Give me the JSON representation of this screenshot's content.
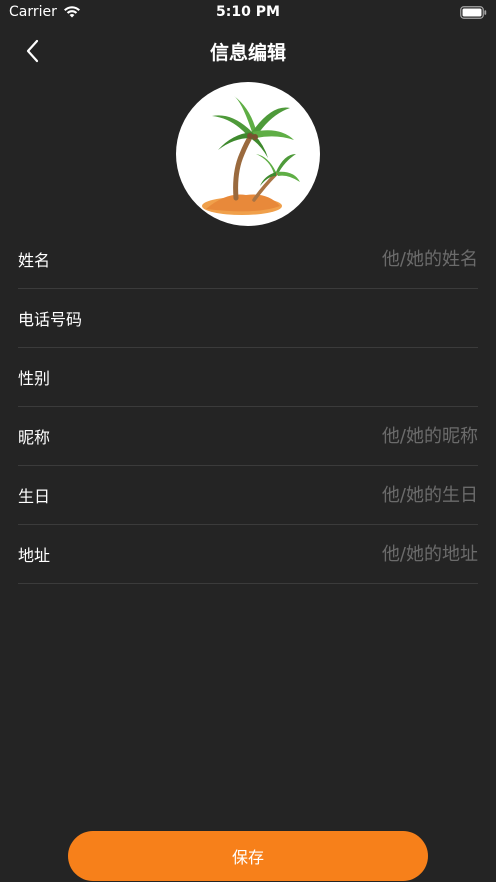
{
  "status_bar": {
    "carrier": "Carrier",
    "time": "5:10 PM"
  },
  "nav": {
    "title": "信息编辑",
    "back_icon": "chevron-left-icon"
  },
  "avatar": {
    "image": "palm-tree-island"
  },
  "form": {
    "fields": [
      {
        "label": "姓名",
        "placeholder": "他/她的姓名",
        "value": ""
      },
      {
        "label": "电话号码",
        "placeholder": "",
        "value": ""
      },
      {
        "label": "性别",
        "placeholder": "",
        "value": ""
      },
      {
        "label": "昵称",
        "placeholder": "他/她的昵称",
        "value": ""
      },
      {
        "label": "生日",
        "placeholder": "他/她的生日",
        "value": ""
      },
      {
        "label": "地址",
        "placeholder": "他/她的地址",
        "value": ""
      }
    ]
  },
  "save_button": {
    "label": "保存"
  },
  "colors": {
    "background": "#242424",
    "accent": "#f7801a",
    "divider": "#3b3b3b",
    "placeholder": "#6b6b6b"
  }
}
